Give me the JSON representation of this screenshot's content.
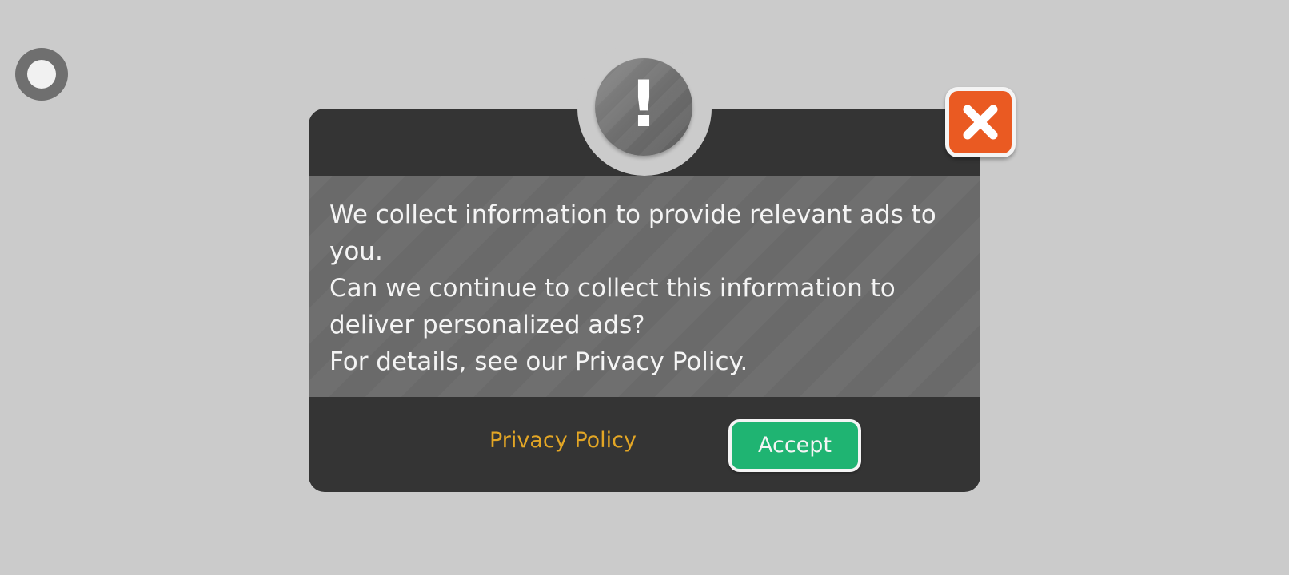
{
  "overlay": {
    "corner_button_icon": "radio-circle-icon"
  },
  "dialog": {
    "header_icon": "exclamation-icon",
    "header_mark": "!",
    "close_icon": "close-x-icon",
    "message_lines": [
      "We collect information to provide relevant ads to you.",
      "Can we continue to collect this information to deliver personalized ads?",
      "For details, see our Privacy Policy."
    ],
    "privacy_link_label": "Privacy Policy",
    "accept_label": "Accept"
  },
  "colors": {
    "background": "#cbcbcb",
    "dialog_dark": "#343434",
    "dialog_body": "#6a6a6a",
    "close_orange": "#ea5a22",
    "accept_green": "#1fb472",
    "link_gold": "#e3a625"
  }
}
